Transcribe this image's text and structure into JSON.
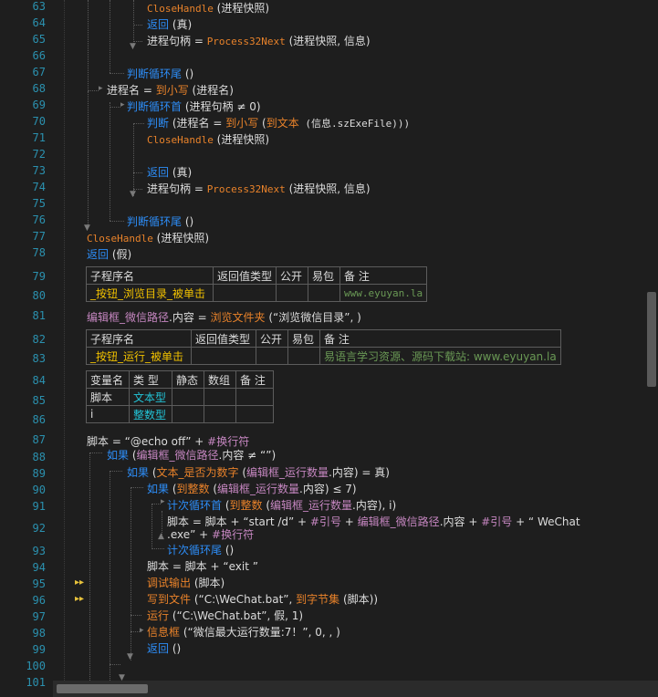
{
  "line_numbers": [
    "63",
    "64",
    "65",
    "66",
    "67",
    "68",
    "69",
    "70",
    "71",
    "72",
    "73",
    "74",
    "75",
    "76",
    "77",
    "78",
    "79",
    "80",
    "81",
    "82",
    "83",
    "84",
    "85",
    "86",
    "87",
    "88",
    "89",
    "90",
    "91",
    "92",
    "93",
    "94",
    "95",
    "96",
    "97",
    "98",
    "99",
    "100",
    "101"
  ],
  "code": {
    "l63": {
      "a": "CloseHandle",
      "b": " (进程快照)"
    },
    "l64": {
      "a": "返回",
      "b": " (真)"
    },
    "l65": {
      "a": "进程句柄 = ",
      "b": "Process32Next",
      "c": " (进程快照, 信息)"
    },
    "l67": {
      "a": "判断循环尾",
      "b": " ()"
    },
    "l68": {
      "a": "进程名 = ",
      "b": "到小写",
      "c": " (进程名)"
    },
    "l69": {
      "a": "判断循环首",
      "b": " (进程句柄 ≠ 0)"
    },
    "l70": {
      "a": "判断",
      "b": " (进程名 = ",
      "c": "到小写",
      "d": " (",
      "e": "到文本",
      "f": " (信息.szExeFile)))"
    },
    "l71": {
      "a": "CloseHandle",
      "b": " (进程快照)"
    },
    "l73": {
      "a": "返回",
      "b": " (真)"
    },
    "l74": {
      "a": "进程句柄 = ",
      "b": "Process32Next",
      "c": " (进程快照, 信息)"
    },
    "l76": {
      "a": "判断循环尾",
      "b": " ()"
    },
    "l77": {
      "a": "CloseHandle",
      "b": " (进程快照)"
    },
    "l78": {
      "a": "返回",
      "b": " (假)"
    },
    "l81": {
      "a": "编辑框_微信路径",
      "b": ".内容 = ",
      "c": "浏览文件夹",
      "d": " (“浏览微信目录”, )"
    },
    "l87": {
      "a": "脚本 = “@echo off” + ",
      "b": "#换行符"
    },
    "l88": {
      "a": "如果",
      "b": " (",
      "c": "编辑框_微信路径",
      "d": ".内容 ≠ “”)"
    },
    "l89": {
      "a": "如果",
      "b": " (",
      "c": "文本_是否为数字",
      "d": " (",
      "e": "编辑框_运行数量",
      "f": ".内容) = 真)"
    },
    "l90": {
      "a": "如果",
      "b": " (",
      "c": "到整数",
      "d": " (",
      "e": "编辑框_运行数量",
      "f": ".内容) ≤ 7)"
    },
    "l91": {
      "a": "计次循环首",
      "b": " (",
      "c": "到整数",
      "d": " (",
      "e": "编辑框_运行数量",
      "f": ".内容), i)"
    },
    "l92a": {
      "a": "脚本 = 脚本 + “start /d” + ",
      "b": "#引号",
      "c": " + ",
      "d": "编辑框_微信路径",
      "e": ".内容 + ",
      "f": "#引号",
      "g": " + “ WeChat"
    },
    "l92b": {
      "a": ".exe” + ",
      "b": "#换行符"
    },
    "l93": {
      "a": "计次循环尾",
      "b": " ()"
    },
    "l94": {
      "a": "脚本 = 脚本 + “exit ”"
    },
    "l95": {
      "a": "调试输出",
      "b": " (脚本)"
    },
    "l96": {
      "a": "写到文件",
      "b": " (“C:\\WeChat.bat”, ",
      "c": "到字节集",
      "d": " (脚本))"
    },
    "l97": {
      "a": "运行",
      "b": " (“C:\\WeChat.bat”, 假, 1)"
    },
    "l98": {
      "a": "信息框",
      "b": " (“微信最大运行数量:7！”, 0, , )"
    },
    "l99": {
      "a": "返回",
      "b": " ()"
    }
  },
  "table1": {
    "headers": [
      "子程序名",
      "返回值类型",
      "公开",
      "易包",
      "备 注"
    ],
    "name": "_按钮_浏览目录_被单击",
    "remark": "www.eyuyan.la"
  },
  "table2": {
    "headers": [
      "子程序名",
      "返回值类型",
      "公开",
      "易包",
      "备 注"
    ],
    "name": "_按钮_运行_被单击",
    "remark": "易语言学习资源、源码下载站: www.eyuyan.la"
  },
  "table3": {
    "headers": [
      "变量名",
      "类 型",
      "静态",
      "数组",
      "备 注"
    ],
    "rows": [
      {
        "name": "脚本",
        "type": "文本型"
      },
      {
        "name": "i",
        "type": "整数型"
      }
    ]
  },
  "breakpoint_icon": "▸▸",
  "colors": {
    "background": "#1e1e1e",
    "line_number": "#2b91af",
    "keyword": "#2d8df7",
    "function": "#e8822a",
    "variable": "#c586c0",
    "subname": "#f0c000",
    "remark": "#6a9955",
    "type": "#22c3d6"
  }
}
